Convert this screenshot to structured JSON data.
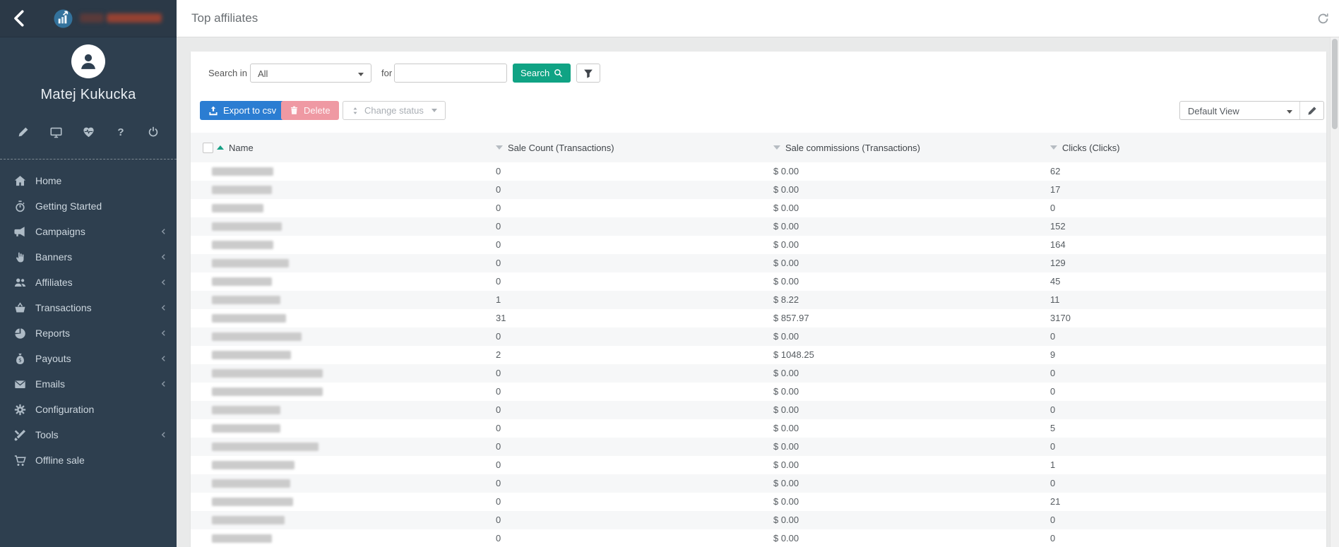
{
  "sidebar": {
    "user_name": "Matej Kukucka",
    "menu": [
      {
        "label": "Home",
        "icon": "home",
        "has_submenu": false
      },
      {
        "label": "Getting Started",
        "icon": "stopwatch",
        "has_submenu": false
      },
      {
        "label": "Campaigns",
        "icon": "megaphone",
        "has_submenu": true
      },
      {
        "label": "Banners",
        "icon": "pointer",
        "has_submenu": true
      },
      {
        "label": "Affiliates",
        "icon": "users",
        "has_submenu": true
      },
      {
        "label": "Transactions",
        "icon": "basket",
        "has_submenu": true
      },
      {
        "label": "Reports",
        "icon": "pie",
        "has_submenu": true
      },
      {
        "label": "Payouts",
        "icon": "moneybag",
        "has_submenu": true
      },
      {
        "label": "Emails",
        "icon": "envelope",
        "has_submenu": true
      },
      {
        "label": "Configuration",
        "icon": "gear",
        "has_submenu": false
      },
      {
        "label": "Tools",
        "icon": "tools",
        "has_submenu": true
      },
      {
        "label": "Offline sale",
        "icon": "cart",
        "has_submenu": false
      }
    ]
  },
  "topbar": {
    "title": "Top affiliates"
  },
  "filters": {
    "search_in_label": "Search in",
    "scope_value": "All",
    "for_label": "for",
    "query_value": "",
    "search_button_label": "Search"
  },
  "toolbar": {
    "export_label": "Export to csv",
    "delete_label": "Delete",
    "change_status_label": "Change status",
    "view_value": "Default View"
  },
  "colors": {
    "accent_teal": "#10a384",
    "export_blue": "#2b7dd2",
    "delete_pink": "#ef99a3",
    "sidebar_bg": "#2e3f4f"
  },
  "table": {
    "columns": [
      {
        "label": "Name",
        "sort": "asc"
      },
      {
        "label": "Sale Count (Transactions)",
        "sort": "none"
      },
      {
        "label": "Sale commissions (Transactions)",
        "sort": "none"
      },
      {
        "label": "Clicks (Clicks)",
        "sort": "none"
      }
    ],
    "rows": [
      {
        "sale_count": "0",
        "commission": "$ 0.00",
        "clicks": "62",
        "blob_w": 87
      },
      {
        "sale_count": "0",
        "commission": "$ 0.00",
        "clicks": "17",
        "blob_w": 85
      },
      {
        "sale_count": "0",
        "commission": "$ 0.00",
        "clicks": "0",
        "blob_w": 73
      },
      {
        "sale_count": "0",
        "commission": "$ 0.00",
        "clicks": "152",
        "blob_w": 99
      },
      {
        "sale_count": "0",
        "commission": "$ 0.00",
        "clicks": "164",
        "blob_w": 87
      },
      {
        "sale_count": "0",
        "commission": "$ 0.00",
        "clicks": "129",
        "blob_w": 109
      },
      {
        "sale_count": "0",
        "commission": "$ 0.00",
        "clicks": "45",
        "blob_w": 85
      },
      {
        "sale_count": "1",
        "commission": "$ 8.22",
        "clicks": "11",
        "blob_w": 97
      },
      {
        "sale_count": "31",
        "commission": "$ 857.97",
        "clicks": "3170",
        "blob_w": 105
      },
      {
        "sale_count": "0",
        "commission": "$ 0.00",
        "clicks": "0",
        "blob_w": 127
      },
      {
        "sale_count": "2",
        "commission": "$ 1048.25",
        "clicks": "9",
        "blob_w": 112
      },
      {
        "sale_count": "0",
        "commission": "$ 0.00",
        "clicks": "0",
        "blob_w": 157
      },
      {
        "sale_count": "0",
        "commission": "$ 0.00",
        "clicks": "0",
        "blob_w": 157
      },
      {
        "sale_count": "0",
        "commission": "$ 0.00",
        "clicks": "0",
        "blob_w": 97
      },
      {
        "sale_count": "0",
        "commission": "$ 0.00",
        "clicks": "5",
        "blob_w": 97
      },
      {
        "sale_count": "0",
        "commission": "$ 0.00",
        "clicks": "0",
        "blob_w": 151
      },
      {
        "sale_count": "0",
        "commission": "$ 0.00",
        "clicks": "1",
        "blob_w": 117
      },
      {
        "sale_count": "0",
        "commission": "$ 0.00",
        "clicks": "0",
        "blob_w": 111
      },
      {
        "sale_count": "0",
        "commission": "$ 0.00",
        "clicks": "21",
        "blob_w": 115
      },
      {
        "sale_count": "0",
        "commission": "$ 0.00",
        "clicks": "0",
        "blob_w": 103
      },
      {
        "sale_count": "0",
        "commission": "$ 0.00",
        "clicks": "0",
        "blob_w": 85
      }
    ]
  }
}
